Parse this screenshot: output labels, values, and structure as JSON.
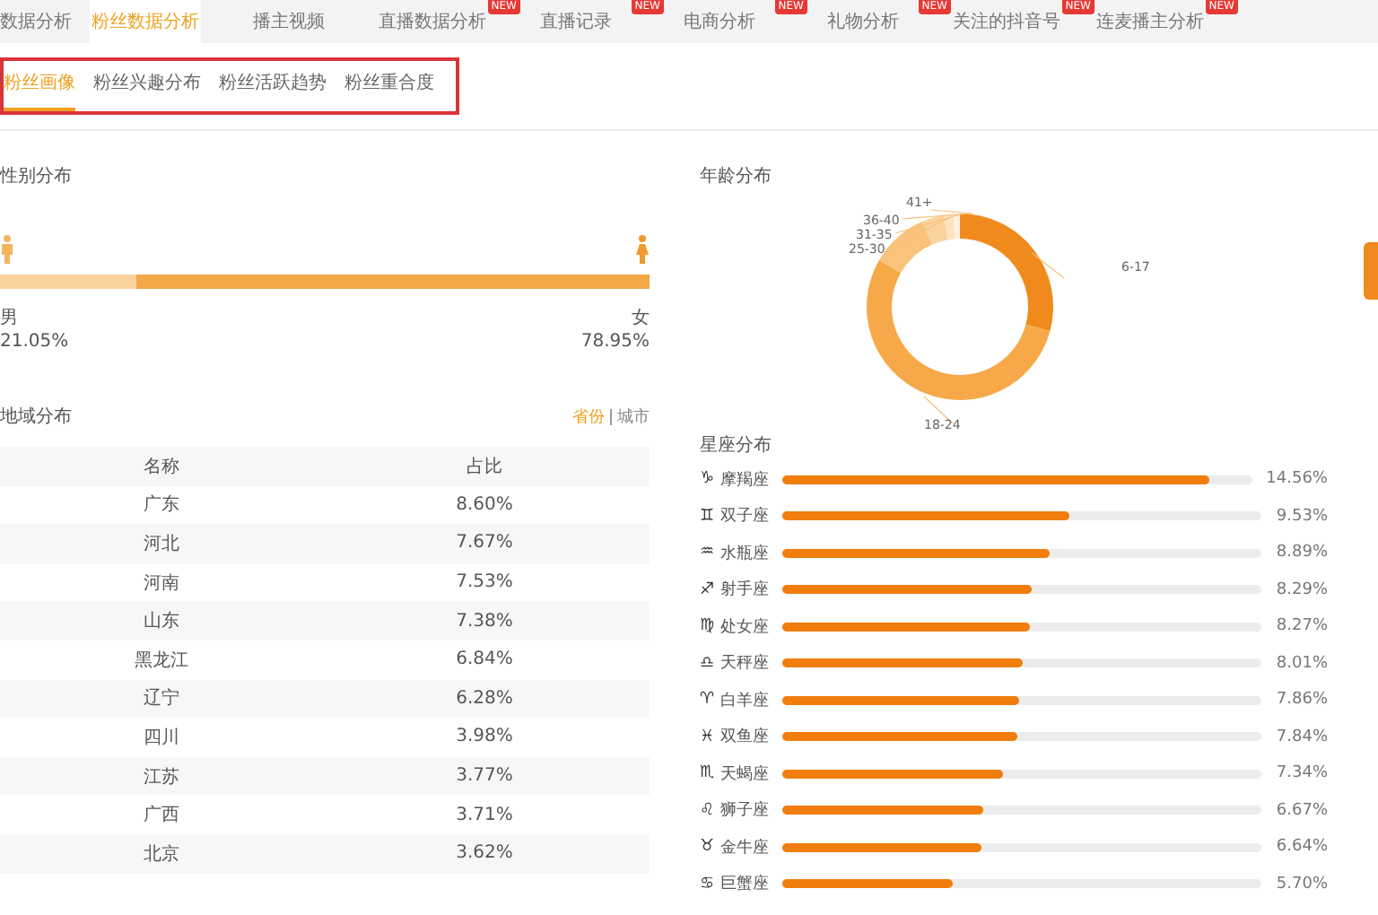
{
  "top_tabs": [
    {
      "label": "数据分析",
      "selected": false
    },
    {
      "label": "粉丝数据分析",
      "selected": true
    },
    {
      "label": "播主视频",
      "selected": false
    },
    {
      "label": "直播数据分析",
      "selected": false,
      "badge": "NEW"
    },
    {
      "label": "直播记录",
      "selected": false,
      "badge": "NEW"
    },
    {
      "label": "电商分析",
      "selected": false,
      "badge": "NEW"
    },
    {
      "label": "礼物分析",
      "selected": false,
      "badge": "NEW"
    },
    {
      "label": "关注的抖音号",
      "selected": false,
      "badge": "NEW"
    },
    {
      "label": "连麦播主分析",
      "selected": false,
      "badge": "NEW"
    }
  ],
  "sub_tabs": [
    {
      "label": "粉丝画像",
      "selected": true
    },
    {
      "label": "粉丝兴趣分布",
      "selected": false
    },
    {
      "label": "粉丝活跃趋势",
      "selected": false
    },
    {
      "label": "粉丝重合度",
      "selected": false
    }
  ],
  "gender": {
    "title": "性别分布",
    "level": 0.2105,
    "male": {
      "label": "男",
      "value": "21.05%"
    },
    "female": {
      "label": "女",
      "value": "78.95%"
    }
  },
  "region": {
    "title": "地域分布",
    "toggle": [
      {
        "label": "省份",
        "selected": true
      },
      {
        "label": "城市",
        "selected": false
      }
    ],
    "columns": [
      "名称",
      "占比"
    ],
    "rows": [
      {
        "name": "广东",
        "share": "8.60%"
      },
      {
        "name": "河北",
        "share": "7.67%"
      },
      {
        "name": "河南",
        "share": "7.53%"
      },
      {
        "name": "山东",
        "share": "7.38%"
      },
      {
        "name": "黑龙江",
        "share": "6.84%"
      },
      {
        "name": "辽宁",
        "share": "6.28%"
      },
      {
        "name": "四川",
        "share": "3.98%"
      },
      {
        "name": "江苏",
        "share": "3.77%"
      },
      {
        "name": "广西",
        "share": "3.71%"
      },
      {
        "name": "北京",
        "share": "3.62%"
      }
    ]
  },
  "age": {
    "title": "年龄分布",
    "labels": [
      "6-17",
      "18-24",
      "25-30",
      "31-35",
      "36-40",
      "41+"
    ]
  },
  "zodiac": {
    "title": "星座分布",
    "rows": [
      {
        "symbol": "♑",
        "name": "摩羯座",
        "level": 0.91,
        "value": "14.56%"
      },
      {
        "symbol": "♊",
        "name": "双子座",
        "level": 0.596,
        "value": "9.53%"
      },
      {
        "symbol": "♒",
        "name": "水瓶座",
        "level": 0.556,
        "value": "8.89%"
      },
      {
        "symbol": "♐",
        "name": "射手座",
        "level": 0.518,
        "value": "8.29%"
      },
      {
        "symbol": "♍",
        "name": "处女座",
        "level": 0.517,
        "value": "8.27%"
      },
      {
        "symbol": "♎",
        "name": "天秤座",
        "level": 0.5,
        "value": "8.01%"
      },
      {
        "symbol": "♈",
        "name": "白羊座",
        "level": 0.491,
        "value": "7.86%"
      },
      {
        "symbol": "♓",
        "name": "双鱼座",
        "level": 0.49,
        "value": "7.84%"
      },
      {
        "symbol": "♏",
        "name": "天蝎座",
        "level": 0.459,
        "value": "7.34%"
      },
      {
        "symbol": "♌",
        "name": "狮子座",
        "level": 0.417,
        "value": "6.67%"
      },
      {
        "symbol": "♉",
        "name": "金牛座",
        "level": 0.415,
        "value": "6.64%"
      },
      {
        "symbol": "♋",
        "name": "巨蟹座",
        "level": 0.356,
        "value": "5.70%"
      }
    ]
  }
}
